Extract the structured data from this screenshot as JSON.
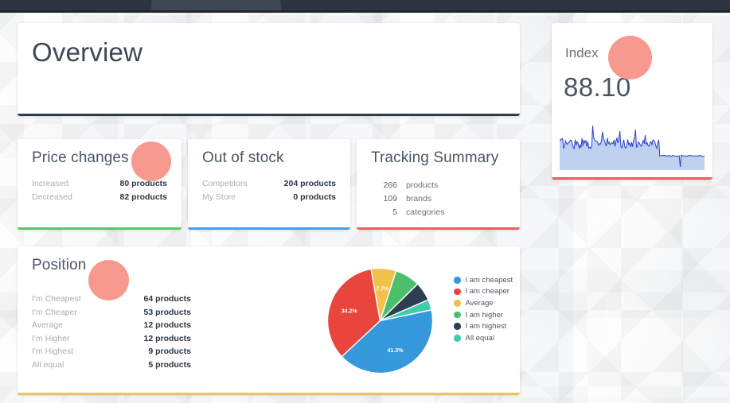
{
  "topbar": {
    "tab_label": ""
  },
  "overview": {
    "title": "Overview",
    "accent_color": "#2f3b4a"
  },
  "price_changes": {
    "title": "Price changes",
    "accent_color": "#5cc46b",
    "rows": [
      {
        "key": "Increased",
        "value": "80 products"
      },
      {
        "key": "Decreased",
        "value": "82 products"
      }
    ]
  },
  "out_of_stock": {
    "title": "Out of stock",
    "accent_color": "#4a9fe0",
    "rows": [
      {
        "key": "Competitors",
        "value": "204 products"
      },
      {
        "key": "My Store",
        "value": "0 products"
      }
    ]
  },
  "tracking_summary": {
    "title": "Tracking Summary",
    "accent_color": "#e4625a",
    "rows": [
      {
        "number": "266",
        "label": "products"
      },
      {
        "number": "109",
        "label": "brands"
      },
      {
        "number": "5",
        "label": "categories"
      }
    ]
  },
  "position": {
    "title": "Position",
    "accent_color": "#e8c45c",
    "rows": [
      {
        "key": "I'm Cheapest",
        "value": "64 products"
      },
      {
        "key": "I'm Cheaper",
        "value": "53 products"
      },
      {
        "key": "Average",
        "value": "12 products"
      },
      {
        "key": "I'm Higher",
        "value": "12 products"
      },
      {
        "key": "I'm Highest",
        "value": "9 products"
      },
      {
        "key": "All equal",
        "value": "5 products"
      }
    ]
  },
  "index": {
    "title": "Index",
    "value": "88.10",
    "accent_color": "#e4625a",
    "sparkline_line_color": "#2b3ecb",
    "sparkline_fill_color": "#bed2f0"
  },
  "chart_data": {
    "type": "pie",
    "title": "Position",
    "legend_position": "right",
    "categories": [
      "I am cheapest",
      "I am cheaper",
      "Average",
      "I am higher",
      "I am highest",
      "All equal"
    ],
    "values": [
      41.3,
      34.2,
      7.7,
      7.7,
      5.8,
      3.2
    ],
    "value_unit": "%",
    "counts": [
      64,
      53,
      12,
      12,
      9,
      5
    ],
    "shown_labels": [
      "41.3%",
      "34.2%",
      "7.7%"
    ],
    "colors": [
      "#3498db",
      "#e8463c",
      "#f2c14b",
      "#4cbf6a",
      "#2c3e50",
      "#3fcba9"
    ],
    "legend": [
      {
        "label": "I am cheapest",
        "color": "#3498db"
      },
      {
        "label": "I am cheaper",
        "color": "#e8463c"
      },
      {
        "label": "Average",
        "color": "#f2c14b"
      },
      {
        "label": "I am higher",
        "color": "#4cbf6a"
      },
      {
        "label": "I am highest",
        "color": "#2c3e50"
      },
      {
        "label": "All equal",
        "color": "#3fcba9"
      }
    ]
  }
}
